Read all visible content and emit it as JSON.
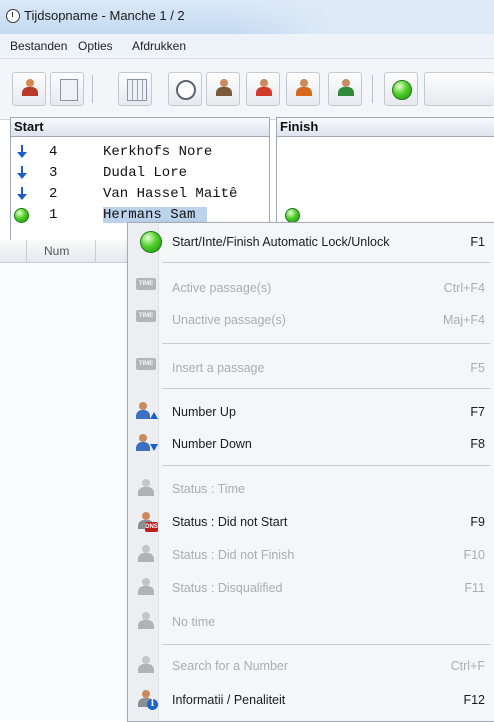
{
  "window": {
    "title": "Tijdsopname -   Manche 1 / 2"
  },
  "menu": [
    "Bestanden",
    "Opties",
    "Afdrukken"
  ],
  "panels": {
    "start_label": "Start",
    "finish_label": "Finish"
  },
  "start_list": [
    {
      "number": "4",
      "name": "Kerkhofs Nore",
      "marker": "arrow-down-icon"
    },
    {
      "number": "3",
      "name": "Dudal Lore",
      "marker": "arrow-down-icon"
    },
    {
      "number": "2",
      "name": "Van Hassel Maitê",
      "marker": "arrow-down-icon"
    },
    {
      "number": "1",
      "name": "Hermans Sam",
      "marker": "green-ball-icon",
      "selected": true
    }
  ],
  "grid": {
    "column_label": "Num"
  },
  "context_menu": {
    "items": [
      {
        "label": "Start/Inte/Finish Automatic Lock/Unlock",
        "shortcut": "F1",
        "enabled": true,
        "icon": "green-ball-icon"
      },
      {
        "label": "Active passage(s)",
        "shortcut": "Ctrl+F4",
        "enabled": false,
        "icon": "active-passage-icon"
      },
      {
        "label": "Unactive passage(s)",
        "shortcut": "Maj+F4",
        "enabled": false,
        "icon": "unactive-passage-icon"
      },
      {
        "label": "Insert a passage",
        "shortcut": "F5",
        "enabled": false,
        "icon": "insert-passage-icon"
      },
      {
        "label": "Number Up",
        "shortcut": "F7",
        "enabled": true,
        "icon": "number-up-icon"
      },
      {
        "label": "Number Down",
        "shortcut": "F8",
        "enabled": true,
        "icon": "number-down-icon"
      },
      {
        "label": "Status : Time",
        "shortcut": "",
        "enabled": false,
        "icon": "status-time-icon"
      },
      {
        "label": "Status : Did not Start",
        "shortcut": "F9",
        "enabled": true,
        "icon": "did-not-start-icon"
      },
      {
        "label": "Status : Did not Finish",
        "shortcut": "F10",
        "enabled": false,
        "icon": "did-not-finish-icon"
      },
      {
        "label": "Status : Disqualified",
        "shortcut": "F11",
        "enabled": false,
        "icon": "disqualified-icon"
      },
      {
        "label": "No time",
        "shortcut": "",
        "enabled": false,
        "icon": "no-time-icon"
      },
      {
        "label": "Search for a Number",
        "shortcut": "Ctrl+F",
        "enabled": false,
        "icon": "search-number-icon"
      },
      {
        "label": "Informatii / Penaliteit",
        "shortcut": "F12",
        "enabled": true,
        "icon": "information-icon"
      }
    ]
  },
  "colors": {
    "accent_blue": "#1b5fc6",
    "status_green": "#4fcf2b",
    "dns_red": "#c01c1c",
    "selection": "#bcd3ec"
  }
}
